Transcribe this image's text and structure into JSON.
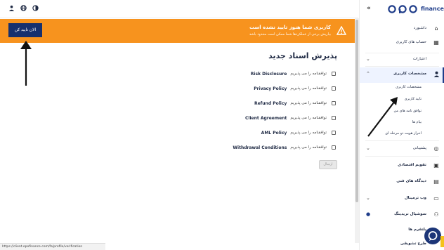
{
  "topbar": {
    "icons": [
      "user-icon",
      "globe-icon",
      "contrast-icon"
    ]
  },
  "banner": {
    "title": "کاربری شما هنوز تایید نشده است",
    "subtitle": "بیاریش برخی از عملکردها شما ممکن است محدود باشد",
    "button_label": "الان تایید کن"
  },
  "main": {
    "title": "پذیرش اسناد جدید",
    "accept_text": "توافقنامه را می پذیریم",
    "documents": [
      "Risk Disclosure",
      "Privacy Policy",
      "Refund Policy",
      "Client Agreement",
      "AML Policy",
      "Withdrawal Conditions"
    ],
    "submit_label": "ارسال"
  },
  "status_url": "https://client.opofinance.com/fa/profile/verification",
  "sidebar": {
    "collapse": "«",
    "logo_text": "finance",
    "items": [
      {
        "label": "داشبورد",
        "icon": "home-icon"
      },
      {
        "label": "حساب های کاربری",
        "icon": "grid-icon"
      },
      {
        "label": "اعتبارات",
        "icon": "chevron-icon"
      },
      {
        "label": "مشخصات کاربری",
        "icon": "user-icon"
      },
      {
        "label": "پشتیبانی",
        "icon": "support-icon"
      },
      {
        "label": "تقویم اقتصادی",
        "icon": "calendar-icon"
      },
      {
        "label": "دیدگاه های فنی",
        "icon": "chart-icon"
      },
      {
        "label": "وب ترمینال",
        "icon": "terminal-icon"
      },
      {
        "label": "سوشیال تریدینگ",
        "icon": "social-icon"
      },
      {
        "label": "پلتفرم ها",
        "icon": "platform-icon"
      },
      {
        "label": "طرح تشویقی",
        "icon": "gift-icon"
      }
    ],
    "sub_items": [
      "مشخصات کاربری",
      "تایید کاربری",
      "توافق نامه های من",
      "بیام ها",
      "احراز هویت دو مرحله ای"
    ]
  },
  "colors": {
    "banner": "#f7931e",
    "primary": "#16306e",
    "brand": "#1f3d8a"
  }
}
